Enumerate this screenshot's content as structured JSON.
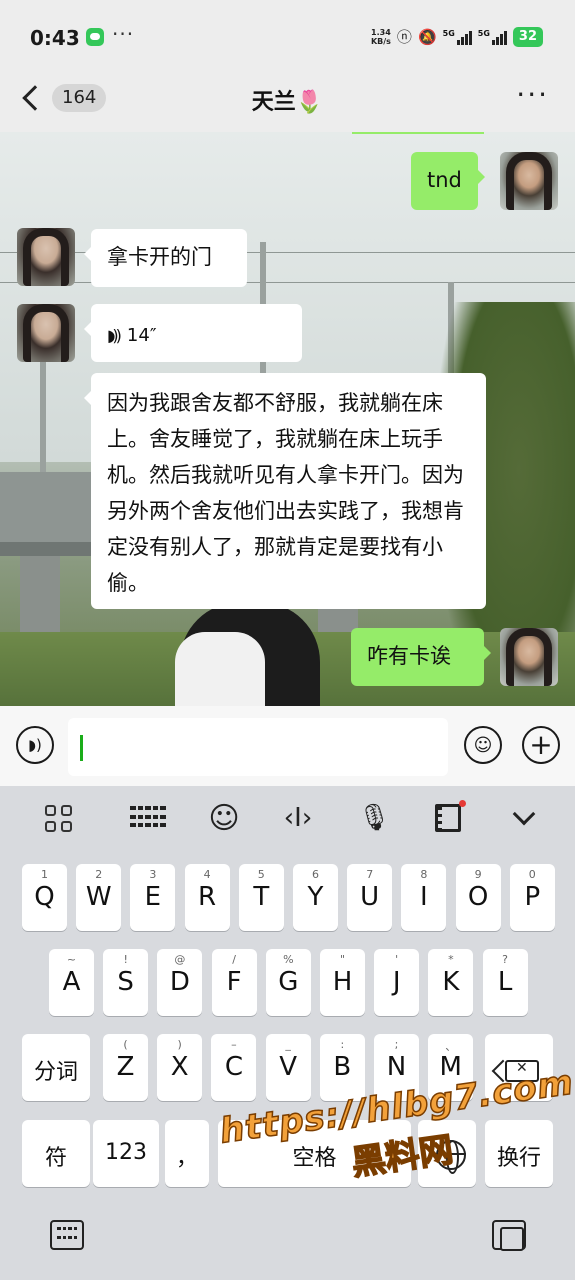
{
  "status_bar": {
    "time": "0:43",
    "more": "···",
    "net_speed_value": "1.34",
    "net_speed_unit": "KB/s",
    "sig1_label": "5G",
    "sig2_label": "5G",
    "battery": "32"
  },
  "header": {
    "unread_count": "164",
    "title": "天兰🌷",
    "more": "···"
  },
  "messages": {
    "sent_1": "tnd",
    "recv_1": "拿卡开的门",
    "voice_duration": "14″",
    "recv_2": "因为我跟舍友都不舒服，我就躺在床上。舍友睡觉了，我就躺在床上玩手机。然后我就听见有人拿卡开门。因为另外两个舍友他们出去实践了，我想肯定没有别人了，那就肯定是要找有小偷。",
    "sent_2": "咋有卡诶"
  },
  "input": {
    "value": ""
  },
  "keyboard": {
    "row1": [
      {
        "main": "Q",
        "sub": "1"
      },
      {
        "main": "W",
        "sub": "2"
      },
      {
        "main": "E",
        "sub": "3"
      },
      {
        "main": "R",
        "sub": "4"
      },
      {
        "main": "T",
        "sub": "5"
      },
      {
        "main": "Y",
        "sub": "6"
      },
      {
        "main": "U",
        "sub": "7"
      },
      {
        "main": "I",
        "sub": "8"
      },
      {
        "main": "O",
        "sub": "9"
      },
      {
        "main": "P",
        "sub": "0"
      }
    ],
    "row2": [
      {
        "main": "A",
        "sub": "~"
      },
      {
        "main": "S",
        "sub": "!"
      },
      {
        "main": "D",
        "sub": "@"
      },
      {
        "main": "F",
        "sub": "/"
      },
      {
        "main": "G",
        "sub": "%"
      },
      {
        "main": "H",
        "sub": "\""
      },
      {
        "main": "J",
        "sub": "'"
      },
      {
        "main": "K",
        "sub": "*"
      },
      {
        "main": "L",
        "sub": "?"
      }
    ],
    "row3_left": "分词",
    "row3": [
      {
        "main": "Z",
        "sub": "("
      },
      {
        "main": "X",
        "sub": ")"
      },
      {
        "main": "C",
        "sub": "–"
      },
      {
        "main": "V",
        "sub": "_"
      },
      {
        "main": "B",
        "sub": ":"
      },
      {
        "main": "N",
        "sub": ";"
      },
      {
        "main": "M",
        "sub": "、"
      }
    ],
    "symbol_key": "符",
    "num_key": "123",
    "comma_key": "，",
    "space_key": "空格",
    "enter_key": "换行"
  },
  "watermark": {
    "url": "https://hlbg7.com",
    "cn": "黑料网"
  },
  "colors": {
    "sent_bubble": "#95ec69",
    "recv_bubble": "#ffffff",
    "accent": "#1aad19",
    "battery": "#34c759",
    "watermark": "#f2a13a"
  }
}
